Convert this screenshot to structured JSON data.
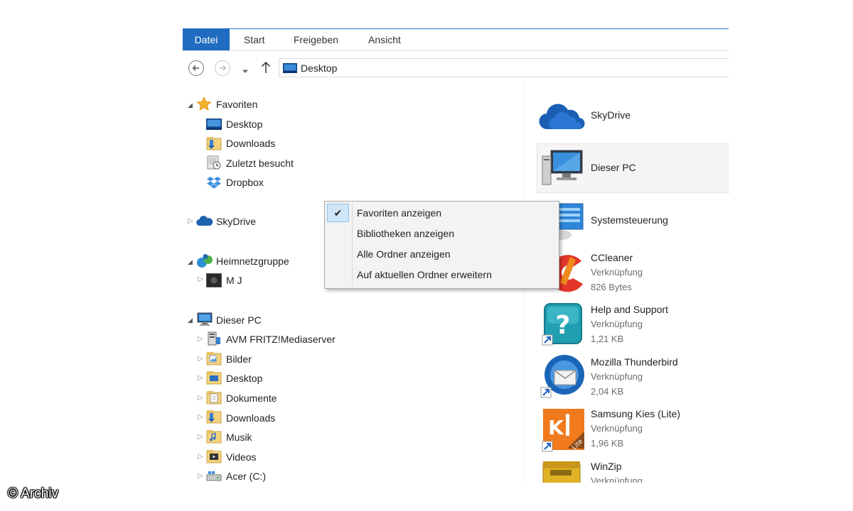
{
  "ribbon": {
    "tabs": [
      {
        "label": "Datei",
        "active": true
      },
      {
        "label": "Start",
        "active": false
      },
      {
        "label": "Freigeben",
        "active": false
      },
      {
        "label": "Ansicht",
        "active": false
      }
    ],
    "accent": "#1f6cc0"
  },
  "address_bar": {
    "location": "Desktop"
  },
  "nav_pane": {
    "favorites": {
      "label": "Favoriten",
      "items": [
        "Desktop",
        "Downloads",
        "Zuletzt besucht",
        "Dropbox"
      ]
    },
    "skydrive": "SkyDrive",
    "homegroup": {
      "label": "Heimnetzgruppe",
      "items": [
        "M J"
      ]
    },
    "this_pc": {
      "label": "Dieser PC",
      "items": [
        "AVM FRITZ!Mediaserver",
        "Bilder",
        "Desktop",
        "Dokumente",
        "Downloads",
        "Musik",
        "Videos",
        "Acer (C:)"
      ]
    }
  },
  "content": {
    "items": [
      {
        "name": "SkyDrive",
        "type": "",
        "size": ""
      },
      {
        "name": "Dieser PC",
        "type": "",
        "size": ""
      },
      {
        "name": "Systemsteuerung",
        "type": "",
        "size": ""
      },
      {
        "name": "CCleaner",
        "type": "Verknüpfung",
        "size": "826 Bytes"
      },
      {
        "name": "Help and Support",
        "type": "Verknüpfung",
        "size": "1,21 KB"
      },
      {
        "name": "Mozilla Thunderbird",
        "type": "Verknüpfung",
        "size": "2,04 KB"
      },
      {
        "name": "Samsung Kies (Lite)",
        "type": "Verknüpfung",
        "size": "1,96 KB"
      },
      {
        "name": "WinZip",
        "type": "Verknüpfung",
        "size": ""
      }
    ]
  },
  "context_menu": {
    "items": [
      {
        "label": "Favoriten anzeigen",
        "checked": true
      },
      {
        "label": "Bibliotheken anzeigen",
        "checked": false
      },
      {
        "label": "Alle Ordner anzeigen",
        "checked": false
      },
      {
        "label": "Auf aktuellen Ordner erweitern",
        "checked": false
      }
    ],
    "check_glyph": "✔"
  },
  "watermark": "© Archiv"
}
